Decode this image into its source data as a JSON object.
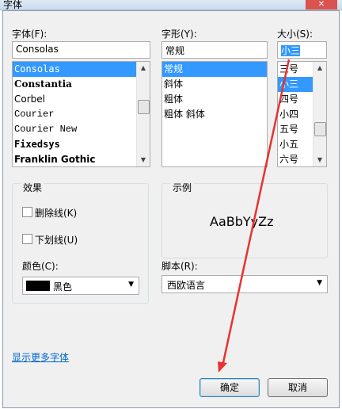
{
  "window": {
    "title": "字体"
  },
  "font": {
    "label": "字体(F):",
    "value": "Consolas",
    "items": [
      {
        "name": "Consolas",
        "selected": true
      },
      {
        "name": "Constantia",
        "selected": false
      },
      {
        "name": "Corbel",
        "selected": false
      },
      {
        "name": "Courier",
        "selected": false
      },
      {
        "name": "Courier New",
        "selected": false
      },
      {
        "name": "Fixedsys",
        "selected": false
      },
      {
        "name": "Franklin Gothic",
        "selected": false
      }
    ]
  },
  "style": {
    "label": "字形(Y):",
    "value": "常规",
    "items": [
      {
        "name": "常规",
        "selected": true
      },
      {
        "name": "斜体",
        "selected": false
      },
      {
        "name": "粗体",
        "selected": false
      },
      {
        "name": "粗体 斜体",
        "selected": false
      }
    ]
  },
  "size": {
    "label": "大小(S):",
    "value": "小三",
    "items": [
      {
        "name": "三号",
        "selected": false
      },
      {
        "name": "小三",
        "selected": true
      },
      {
        "name": "四号",
        "selected": false
      },
      {
        "name": "小四",
        "selected": false
      },
      {
        "name": "五号",
        "selected": false
      },
      {
        "name": "小五",
        "selected": false
      },
      {
        "name": "六号",
        "selected": false
      }
    ]
  },
  "effects": {
    "title": "效果",
    "strikeout": "删除线(K)",
    "underline": "下划线(U)",
    "color_label": "颜色(C):",
    "color_value": "黑色",
    "color_hex": "#000000"
  },
  "sample": {
    "title": "示例",
    "text": "AaBbYyZz"
  },
  "script": {
    "label": "脚本(R):",
    "value": "西欧语言"
  },
  "more_fonts_link": "显示更多字体",
  "buttons": {
    "ok": "确定",
    "cancel": "取消"
  },
  "annotation_color": "#e8322f"
}
